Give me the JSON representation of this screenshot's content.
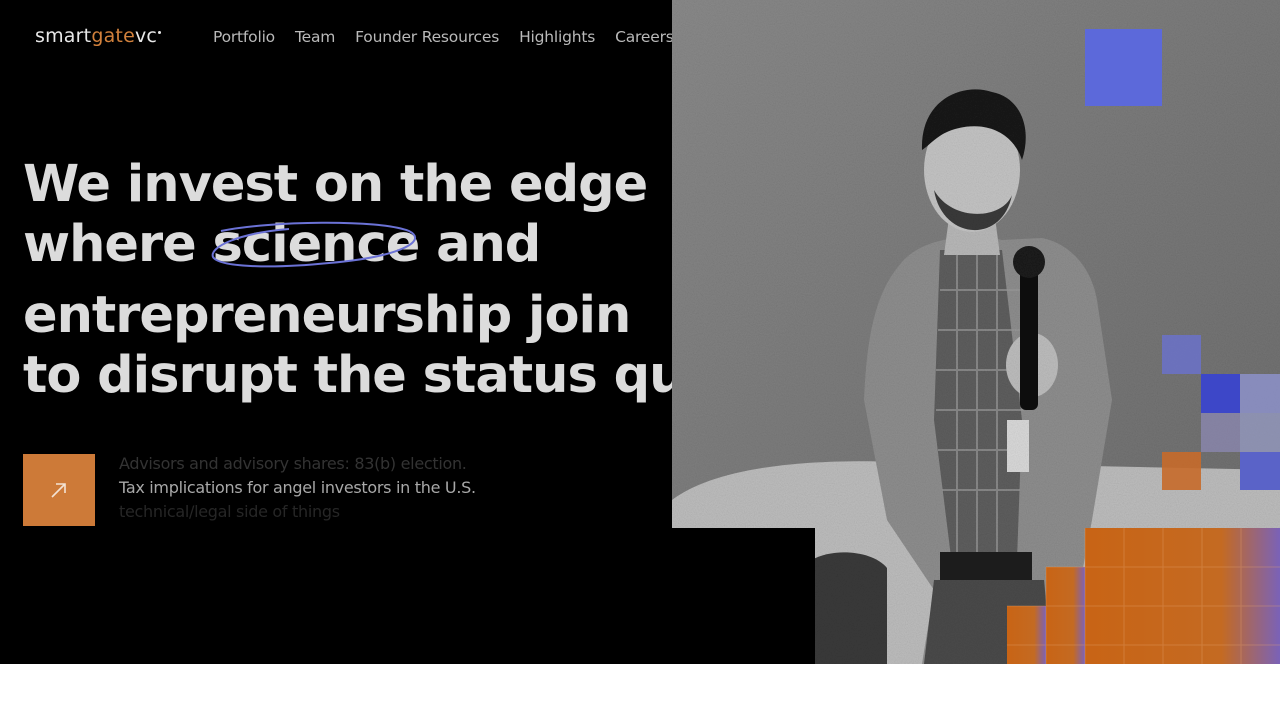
{
  "brand": {
    "logo_part1": "smart",
    "logo_part2": "gate",
    "logo_part3": "vc",
    "logo_text": "smartgatevc",
    "accent_color": "#cd7a38",
    "highlight_color": "#6b72d6"
  },
  "nav": {
    "items": [
      {
        "label": "Portfolio"
      },
      {
        "label": "Team"
      },
      {
        "label": "Founder Resources"
      },
      {
        "label": "Highlights"
      },
      {
        "label": "Careers"
      }
    ]
  },
  "hero": {
    "line1": "We invest on the edge",
    "line2_before": "where ",
    "line2_highlight": "science",
    "line2_after": " and",
    "line3": "entrepreneurship join",
    "line4": "to disrupt the status quo"
  },
  "cta": {
    "icon": "arrow-up-right-icon",
    "ticker": [
      "Advisors and advisory shares: 83(b) election.",
      "Tax implications for angel investors in the U.S.",
      "technical/legal side of things"
    ]
  },
  "photo": {
    "subject": "speaker-with-microphone"
  }
}
